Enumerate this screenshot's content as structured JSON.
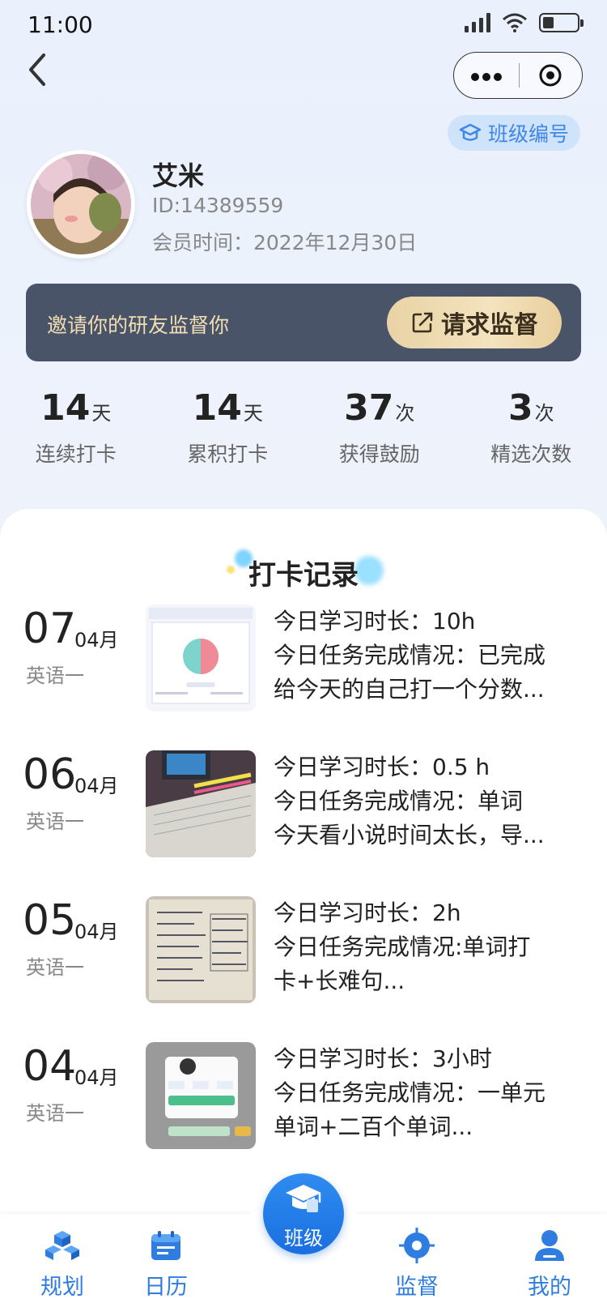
{
  "status_bar": {
    "time": "11:00"
  },
  "header": {
    "class_badge_label": "班级编号"
  },
  "profile": {
    "name": "艾米",
    "id_text": "ID:14389559",
    "member_text": "会员时间：2022年12月30日"
  },
  "invite": {
    "text": "邀请你的研友监督你",
    "button_label": "请求监督"
  },
  "stats": [
    {
      "value": "14",
      "unit": "天",
      "label": "连续打卡"
    },
    {
      "value": "14",
      "unit": "天",
      "label": "累积打卡"
    },
    {
      "value": "37",
      "unit": "次",
      "label": "获得鼓励"
    },
    {
      "value": "3",
      "unit": "次",
      "label": "精选次数"
    }
  ],
  "records_title": "打卡记录",
  "records": [
    {
      "day": "07",
      "month": "04月",
      "subject": "英语一",
      "lines": [
        "今日学习时长：10h",
        "今日任务完成情况：已完成",
        "给今天的自己打一个分数..."
      ]
    },
    {
      "day": "06",
      "month": "04月",
      "subject": "英语一",
      "lines": [
        "今日学习时长：0.5 h",
        "今日任务完成情况：单词",
        "今天看小说时间太长，导..."
      ]
    },
    {
      "day": "05",
      "month": "04月",
      "subject": "英语一",
      "lines": [
        "今日学习时长：2h",
        "今日任务完成情况:单词打",
        "卡+长难句..."
      ]
    },
    {
      "day": "04",
      "month": "04月",
      "subject": "英语一",
      "lines": [
        "今日学习时长：3小时",
        "今日任务完成情况：一单元",
        "单词+二百个单词..."
      ]
    }
  ],
  "tabs": {
    "plan": "规划",
    "calendar": "日历",
    "class": "班级",
    "supervise": "监督",
    "mine": "我的"
  },
  "colors": {
    "accent": "#2f7de1",
    "invite_bg": "#4a5468",
    "gold": "#e9d3a5"
  }
}
